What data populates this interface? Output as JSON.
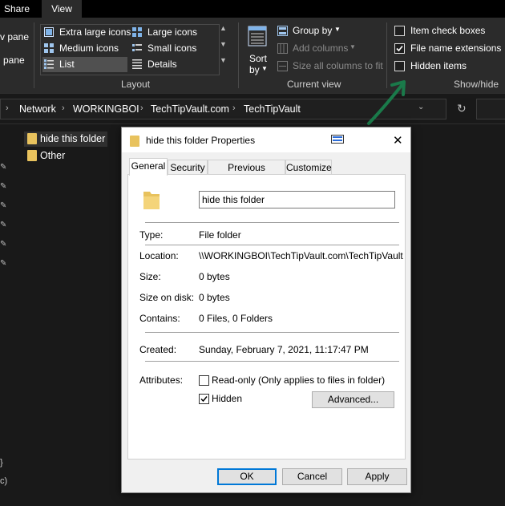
{
  "ribbon_tabs": [
    "Share",
    "View"
  ],
  "ribbon": {
    "panes": [
      "v pane",
      "pane"
    ],
    "layout": {
      "items": [
        "Extra large icons",
        "Large icons",
        "Medium icons",
        "Small icons",
        "List",
        "Details"
      ],
      "selected": "List",
      "group_label": "Layout"
    },
    "current_view": {
      "sort_by_line1": "Sort",
      "sort_by_line2": "by",
      "group_by": "Group by",
      "add_columns": "Add columns",
      "size_all_columns": "Size all columns to fit",
      "group_label": "Current view"
    },
    "show_hide": {
      "item_check_boxes": {
        "label": "Item check boxes",
        "checked": false
      },
      "file_name_extensions": {
        "label": "File name extensions",
        "checked": true
      },
      "hidden_items": {
        "label": "Hidden items",
        "checked": false
      },
      "group_label": "Show/hide"
    }
  },
  "address_bar": {
    "crumbs": [
      "Network",
      "WORKINGBOI",
      "TechTipVault.com",
      "TechTipVault"
    ]
  },
  "folders": [
    {
      "name": "hide this folder",
      "selected": true
    },
    {
      "name": "Other",
      "selected": false
    }
  ],
  "sidebar_bottom": [
    "}",
    "c)"
  ],
  "dialog": {
    "title": "hide this folder Properties",
    "tabs": [
      "General",
      "Security",
      "Previous Versions",
      "Customize"
    ],
    "active_tab": "General",
    "name_value": "hide this folder",
    "fields": {
      "type_label": "Type:",
      "type_value": "File folder",
      "location_label": "Location:",
      "location_value": "\\\\WORKINGBOI\\TechTipVault.com\\TechTipVault",
      "size_label": "Size:",
      "size_value": "0 bytes",
      "size_on_disk_label": "Size on disk:",
      "size_on_disk_value": "0 bytes",
      "contains_label": "Contains:",
      "contains_value": "0 Files, 0 Folders",
      "created_label": "Created:",
      "created_value": "Sunday, February 7, 2021, 11:17:47 PM",
      "attributes_label": "Attributes:"
    },
    "attributes": {
      "read_only": {
        "label": "Read-only (Only applies to files in folder)",
        "checked": false
      },
      "hidden": {
        "label": "Hidden",
        "checked": true
      }
    },
    "advanced_button": "Advanced...",
    "buttons": {
      "ok": "OK",
      "cancel": "Cancel",
      "apply": "Apply"
    }
  },
  "colors": {
    "annotation_arrow": "#1a7a4a",
    "selection_accent": "#0078d7",
    "folder": "#e8c25d"
  }
}
